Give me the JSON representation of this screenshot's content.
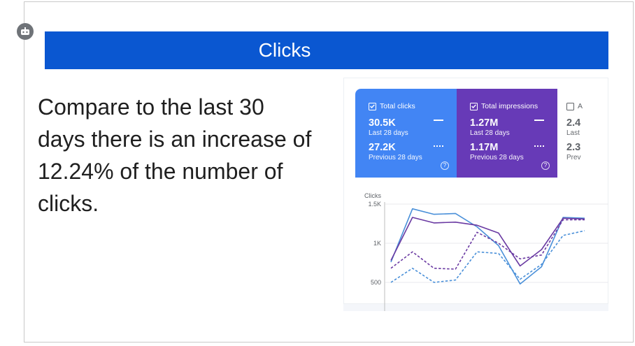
{
  "slide": {
    "title": "Clicks",
    "body": "Compare to the last 30 days there is an increase of 12.24% of the number of clicks."
  },
  "icons": {
    "badge": "robot-icon",
    "checkbox": "checkbox-checked-icon",
    "help": "help-circle-icon"
  },
  "colors": {
    "title_bar": "#0a57d1",
    "clicks": "#4285f4",
    "impressions": "#673ab7"
  },
  "metrics": {
    "clicks": {
      "label": "Total clicks",
      "current_value": "30.5K",
      "current_period": "Last 28 days",
      "previous_value": "27.2K",
      "previous_period": "Previous 28 days",
      "help": "?"
    },
    "impressions": {
      "label": "Total impressions",
      "current_value": "1.27M",
      "current_period": "Last 28 days",
      "previous_value": "1.17M",
      "previous_period": "Previous 28 days",
      "help": "?"
    },
    "third": {
      "label": "A",
      "current_value": "2.4",
      "current_period": "Last",
      "previous_value": "2.3",
      "previous_period": "Prev"
    }
  },
  "chart_data": {
    "type": "line",
    "ylabel": "Clicks",
    "yticks": [
      "1.5K",
      "1K",
      "500"
    ],
    "ytick_values": [
      1500,
      1000,
      500
    ],
    "ylim": [
      250,
      1500
    ],
    "x": [
      0,
      1,
      2,
      3,
      4,
      5,
      6,
      7,
      8,
      9
    ],
    "series": [
      {
        "style": "solid",
        "color": "#4a90d9",
        "values": [
          760,
          1440,
          1370,
          1380,
          1210,
          970,
          480,
          700,
          1330,
          1320
        ]
      },
      {
        "style": "solid",
        "color": "#6a3aa2",
        "values": [
          780,
          1330,
          1260,
          1270,
          1230,
          1130,
          710,
          920,
          1320,
          1310
        ]
      },
      {
        "style": "dashed",
        "color": "#6a3aa2",
        "values": [
          680,
          890,
          680,
          670,
          1140,
          1000,
          800,
          850,
          1300,
          1300
        ]
      },
      {
        "style": "dashed",
        "color": "#4a90d9",
        "values": [
          500,
          680,
          500,
          530,
          890,
          870,
          540,
          730,
          1100,
          1160
        ]
      }
    ]
  }
}
